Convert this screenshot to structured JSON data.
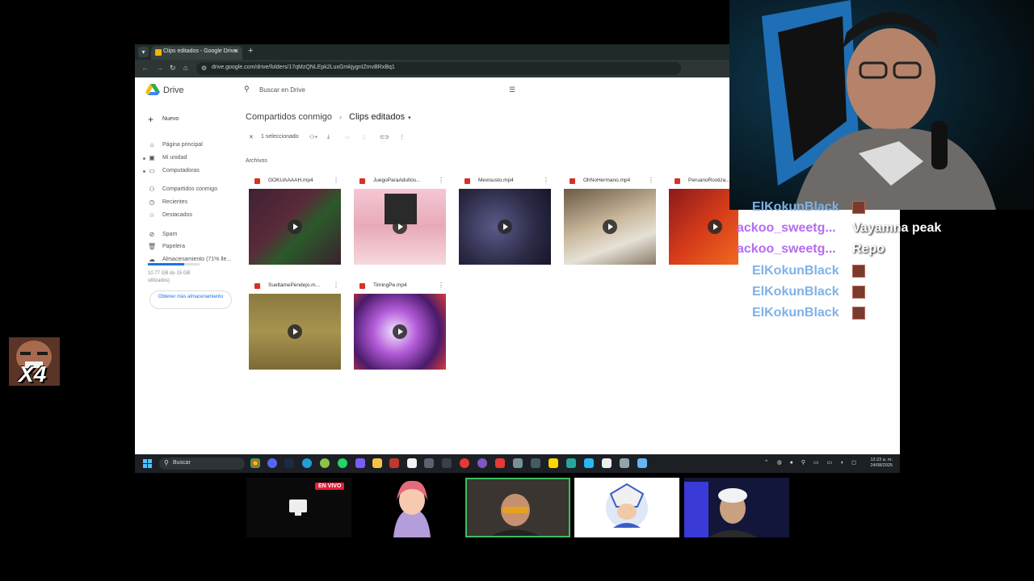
{
  "browser": {
    "tab_title": "Clips editados - Google Drive",
    "url": "drive.google.com/drive/folders/17qMzQNLEpk2LuxGmkjygnIZmvBRxBq1"
  },
  "drive": {
    "app_name": "Drive",
    "search_placeholder": "Buscar en Drive",
    "new_label": "Nuevo",
    "nav": [
      {
        "label": "Página principal",
        "icon": "home-icon"
      },
      {
        "label": "Mi unidad",
        "icon": "drive-icon"
      },
      {
        "label": "Computadoras",
        "icon": "computer-icon"
      },
      {
        "label": "Compartidos conmigo",
        "icon": "people-icon"
      },
      {
        "label": "Recientes",
        "icon": "clock-icon"
      },
      {
        "label": "Destacados",
        "icon": "star-icon"
      },
      {
        "label": "Spam",
        "icon": "spam-icon"
      },
      {
        "label": "Papelera",
        "icon": "trash-icon"
      },
      {
        "label": "Almacenamiento (71% lle...",
        "icon": "cloud-icon"
      }
    ],
    "storage_percent": 71,
    "storage_text": "10.77 GB de 15 GB utilizados)",
    "get_more_label": "Obtener más almacenamiento",
    "breadcrumb": {
      "parent": "Compartidos conmigo",
      "current": "Clips editados"
    },
    "selection_text": "1 seleccionado",
    "section_label": "Archivos",
    "files": [
      {
        "name": "GOKUAAAAH.mp4"
      },
      {
        "name": "JuegoParaAdultos..."
      },
      {
        "name": "Mexisusto.mp4"
      },
      {
        "name": "OhNoHermano.mp4"
      },
      {
        "name": "PeruanoRostiza..."
      },
      {
        "name": "SueltamePendejo.m..."
      },
      {
        "name": "TimingPe.mp4"
      }
    ]
  },
  "taskbar": {
    "search_label": "Buscar",
    "time": "12:23 a. m.",
    "date": "24/08/2025"
  },
  "chat": [
    {
      "user": "ElKokunBlack",
      "message": "",
      "color": "#7fb2e6"
    },
    {
      "user": "ackoo_sweetg...",
      "message": "Vayamna peak",
      "color": "#b56cf0"
    },
    {
      "user": "ackoo_sweetg...",
      "message": "Repo",
      "color": "#b56cf0"
    },
    {
      "user": "ElKokunBlack",
      "message": "",
      "color": "#7fb2e6"
    },
    {
      "user": "ElKokunBlack",
      "message": "",
      "color": "#7fb2e6"
    },
    {
      "user": "ElKokunBlack",
      "message": "",
      "color": "#7fb2e6"
    }
  ],
  "badge": {
    "text": "X4"
  },
  "guests": {
    "live_label": "EN VIVO"
  }
}
